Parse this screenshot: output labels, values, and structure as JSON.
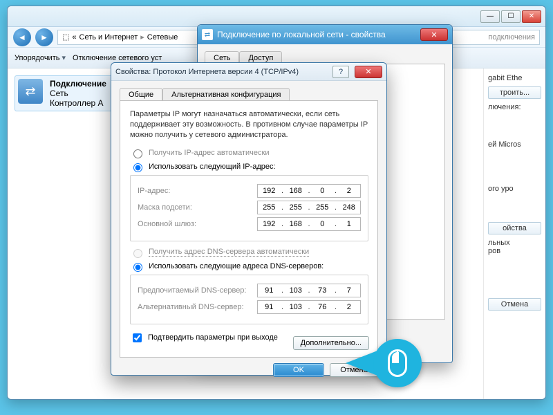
{
  "explorer": {
    "breadcrumb": {
      "seg1": "Сеть и Интернет",
      "seg2": "Сетевые",
      "hint": "подключения"
    },
    "toolbar": {
      "organize": "Упорядочить",
      "disable": "Отключение сетевого уст"
    },
    "item": {
      "title": "Подключение",
      "line2": "Сеть",
      "line3": "Контроллер A"
    },
    "side": {
      "gigabit": "gabit Ethe",
      "configure": "троить...",
      "conn_label": "лючения:",
      "microsoft": "ей Micros",
      "level": "ого уро",
      "props": "ойства",
      "localprops": "льных\nров",
      "cancel": "Отмена"
    },
    "winbtns": {
      "min": "—",
      "max": "☐",
      "close": "✕"
    }
  },
  "props": {
    "title": "Подключение по локальной сети - свойства",
    "tabs": {
      "net": "Сеть",
      "access": "Доступ"
    }
  },
  "ipv4": {
    "title": "Свойства: Протокол Интернета версии 4 (TCP/IPv4)",
    "tabs": {
      "general": "Общие",
      "alt": "Альтернативная конфигурация"
    },
    "desc": "Параметры IP могут назначаться автоматически, если сеть поддерживает эту возможность. В противном случае параметры IP можно получить у сетевого администратора.",
    "radio_ip_auto": "Получить IP-адрес автоматически",
    "radio_ip_manual": "Использовать следующий IP-адрес:",
    "radio_dns_auto": "Получить адрес DNS-сервера автоматически",
    "radio_dns_manual": "Использовать следующие адреса DNS-серверов:",
    "labels": {
      "ip": "IP-адрес:",
      "mask": "Маска подсети:",
      "gw": "Основной шлюз:",
      "dns1": "Предпочитаемый DNS-сервер:",
      "dns2": "Альтернативный DNS-сервер:"
    },
    "values": {
      "ip": {
        "o1": "192",
        "o2": "168",
        "o3": "0",
        "o4": "2"
      },
      "mask": {
        "o1": "255",
        "o2": "255",
        "o3": "255",
        "o4": "248"
      },
      "gw": {
        "o1": "192",
        "o2": "168",
        "o3": "0",
        "o4": "1"
      },
      "dns1": {
        "o1": "91",
        "o2": "103",
        "o3": "73",
        "o4": "7"
      },
      "dns2": {
        "o1": "91",
        "o2": "103",
        "o3": "76",
        "o4": "2"
      }
    },
    "validate": "Подтвердить параметры при выходе",
    "advanced": "Дополнительно...",
    "ok": "OK",
    "cancel": "Отмена",
    "help": "?",
    "close": "✕"
  }
}
